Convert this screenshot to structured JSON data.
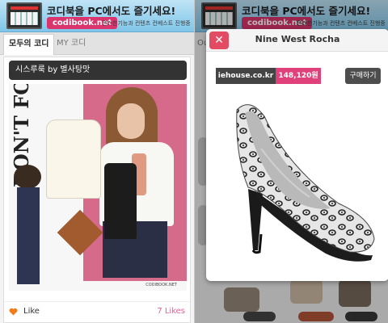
{
  "banner": {
    "headline": "코디북을 PC에서도 즐기세요!",
    "url": "codibook.net",
    "subtext": "편리한기능과 컨텐츠 컨베스트 진행중"
  },
  "tabs": {
    "all": "모두의 코디",
    "mine": "MY 코디"
  },
  "card": {
    "title": "시스루룩  by 별사탕맛",
    "collage_text": "DON'T FORGET",
    "brand_mark": "CODIBOOK.NET",
    "like_label": "Like",
    "likes_count": "7 Likes"
  },
  "right": {
    "tab_peek": "Ou"
  },
  "product": {
    "title": "Nine West Rocha",
    "shop": "iehouse.co.kr",
    "price": "148,120원",
    "buy_label": "구매하기"
  },
  "colors": {
    "accent": "#e0417a",
    "close": "#e34b63",
    "banner_top": "#bfe3f5",
    "banner_bottom": "#7fc6ea"
  },
  "icons": {
    "close": "close-icon",
    "like": "heart-icon"
  }
}
